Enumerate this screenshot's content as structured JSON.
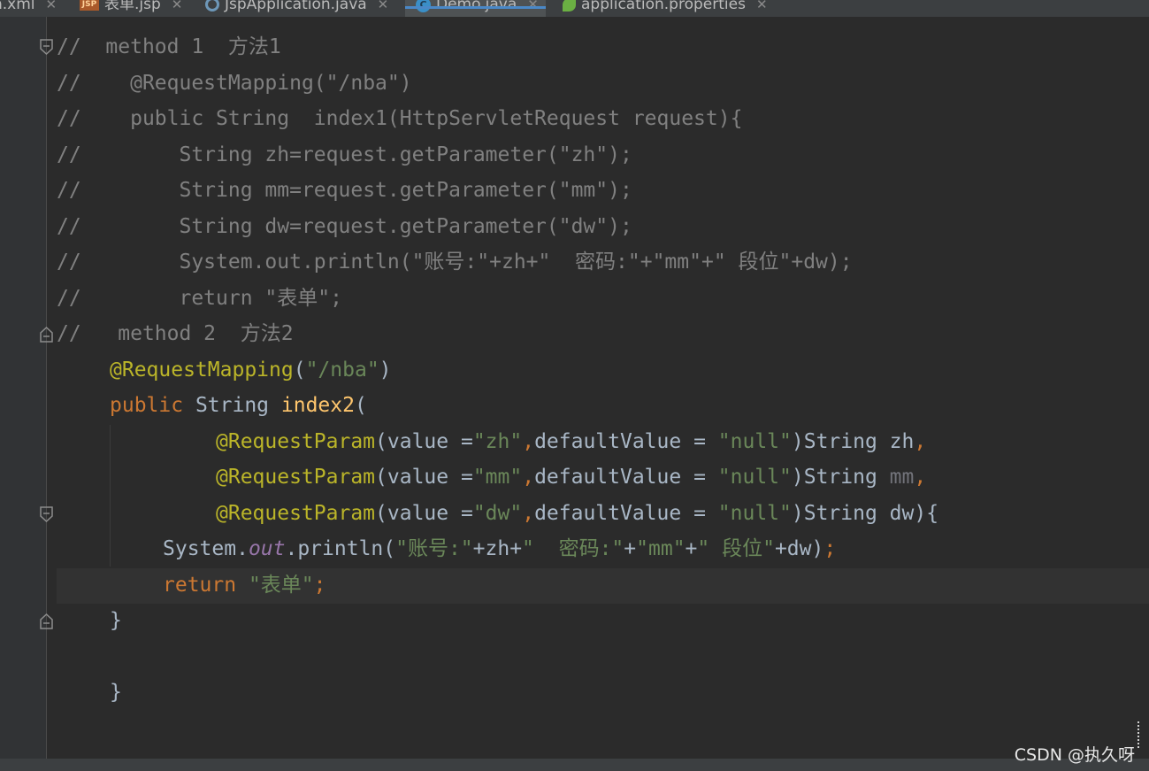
{
  "tabs": [
    {
      "label": "n.xml",
      "icon": "xml-file-icon"
    },
    {
      "label": "表单.jsp",
      "icon": "jsp-file-icon"
    },
    {
      "label": "JspApplication.java",
      "icon": "spring-app-icon"
    },
    {
      "label": "Demo.java",
      "icon": "java-class-icon",
      "active": true
    },
    {
      "label": "application.properties",
      "icon": "properties-leaf-icon"
    }
  ],
  "code": {
    "comment_prefix": "//",
    "l1_text": "  method 1  方法1",
    "l2_text": "    @RequestMapping(\"/nba\")",
    "l3_text": "    public String  index1(HttpServletRequest request){",
    "l4_text": "        String zh=request.getParameter(\"zh\");",
    "l5_text": "        String mm=request.getParameter(\"mm\");",
    "l6_text": "        String dw=request.getParameter(\"dw\");",
    "l7_text": "        System.out.println(\"账号:\"+zh+\"  密码:\"+\"mm\"+\" 段位\"+dw);",
    "l8_text": "        return \"表单\";",
    "l9_text": "   method 2  方法2",
    "ann_request_mapping": "@RequestMapping",
    "open_paren": "(",
    "close_paren": ")",
    "str_nba": "\"/nba\"",
    "kw_public": "public",
    "type_string": " String ",
    "method_index2": "index2",
    "ann_request_param": "@RequestParam",
    "value_eq": "value =",
    "comma": ",",
    "default_value_eq": "defaultValue = ",
    "str_zh": "\"zh\"",
    "str_mm": "\"mm\"",
    "str_dw": "\"dw\"",
    "str_null": "\"null\"",
    "string_kw": "String ",
    "param_zh": "zh",
    "param_mm": "mm",
    "param_dw": "dw",
    "open_brace_end": "){",
    "system": "System.",
    "out": "out",
    "println": ".println(",
    "str_account": "\"账号:\"",
    "plus_zh_plus": "+zh+",
    "str_password": "\"  密码:\"",
    "plus": "+",
    "str_mm_quoted": "\"mm\"",
    "str_rank": "\" 段位\"",
    "plus_dw": "+dw",
    "semicolon": ";",
    "kw_return": "return",
    "str_form": "\"表单\"",
    "close_brace": "}"
  },
  "watermark": "CSDN @执久呀"
}
